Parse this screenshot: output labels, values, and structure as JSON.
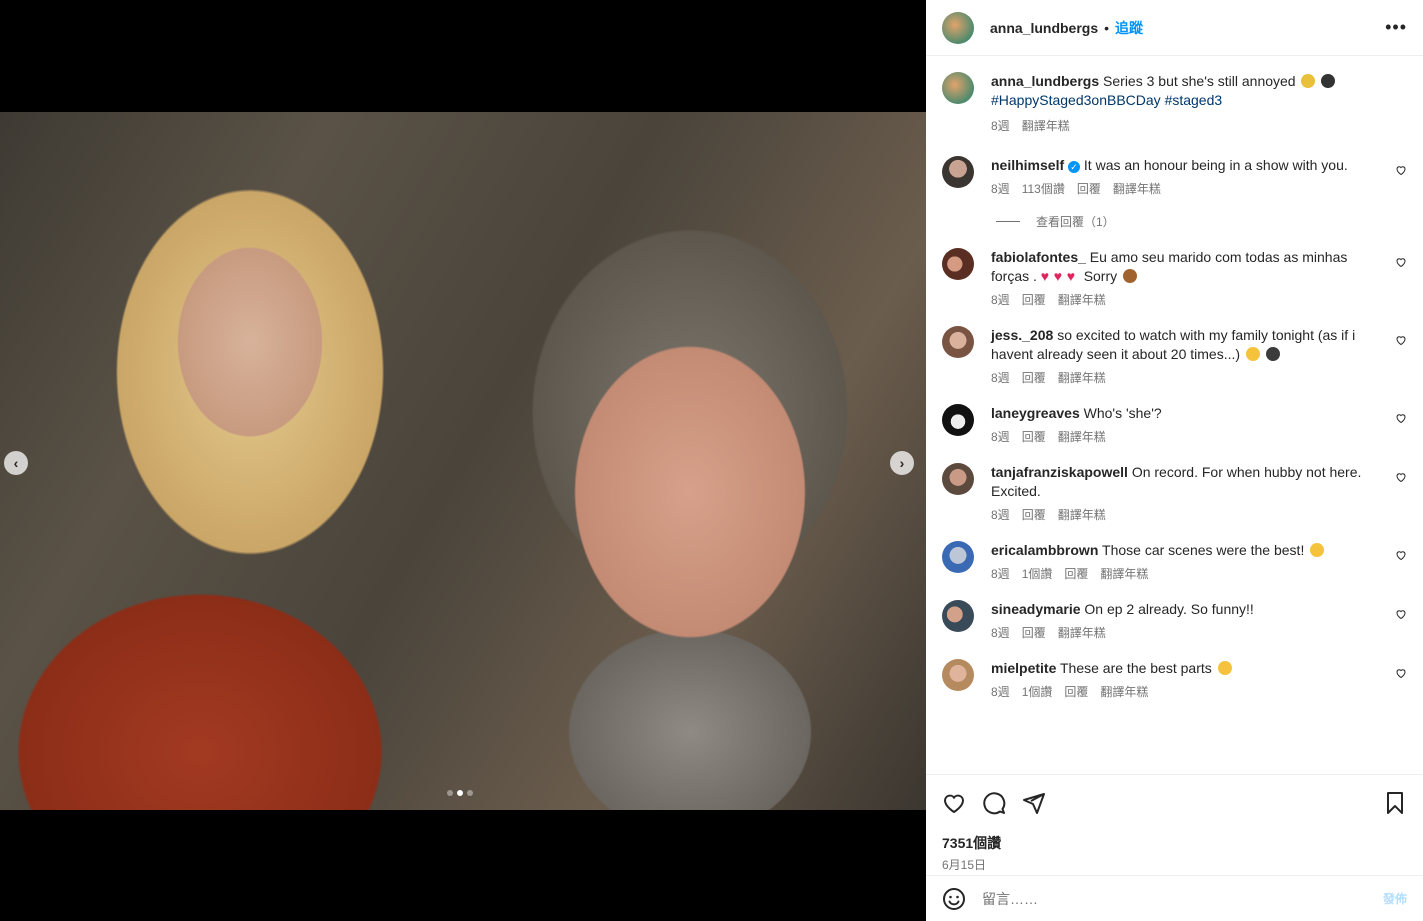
{
  "post": {
    "username": "anna_lundbergs",
    "separator": "•",
    "follow_label": "追蹤",
    "more_icon": "more-horizontal-icon",
    "image_dots": 3,
    "active_dot": 1
  },
  "caption": {
    "username": "anna_lundbergs",
    "text": "Series 3 but she's still annoyed",
    "emoji": [
      "pineapple-emoji",
      "penguins-emoji"
    ],
    "hashtags": [
      "#HappyStaged3onBBCDay",
      "#staged3"
    ],
    "time": "8週",
    "translate": "翻譯年糕"
  },
  "view_replies": "查看回覆（1）",
  "comments": [
    {
      "username": "neilhimself",
      "verified": true,
      "text": "It was an honour being in a show with you.",
      "time": "8週",
      "likes": "113個讚",
      "reply": "回覆",
      "translate": "翻譯年糕"
    },
    {
      "username": "fabiolafontes_",
      "text": "Eu amo seu marido com todas as minhas forças .",
      "text2": "Sorry",
      "time": "8週",
      "reply": "回覆",
      "translate": "翻譯年糕"
    },
    {
      "username": "jess._208",
      "text": "so excited to watch with my family tonight (as if i havent already seen it about 20 times...)",
      "time": "8週",
      "reply": "回覆",
      "translate": "翻譯年糕"
    },
    {
      "username": "laneygreaves",
      "text": "Who's 'she'?",
      "time": "8週",
      "reply": "回覆",
      "translate": "翻譯年糕"
    },
    {
      "username": "tanjafranziskapowell",
      "text": "On record. For when hubby not here. Excited.",
      "time": "8週",
      "reply": "回覆",
      "translate": "翻譯年糕"
    },
    {
      "username": "ericalambbrown",
      "text": "Those car scenes were the best!",
      "time": "8週",
      "likes": "1個讚",
      "reply": "回覆",
      "translate": "翻譯年糕"
    },
    {
      "username": "sineadymarie",
      "text": "On ep 2 already. So funny!!",
      "time": "8週",
      "reply": "回覆",
      "translate": "翻譯年糕"
    },
    {
      "username": "mielpetite",
      "text": "These are the best parts",
      "time": "8週",
      "likes": "1個讚",
      "reply": "回覆",
      "translate": "翻譯年糕"
    }
  ],
  "footer": {
    "likes": "7351個讚",
    "date": "6月15日",
    "comment_placeholder": "留言……",
    "post_label": "發佈"
  },
  "colors": {
    "accent": "#0095f6",
    "text": "#262626",
    "muted": "#737373",
    "hashtag": "#00376b",
    "heart": "#e0245e"
  }
}
